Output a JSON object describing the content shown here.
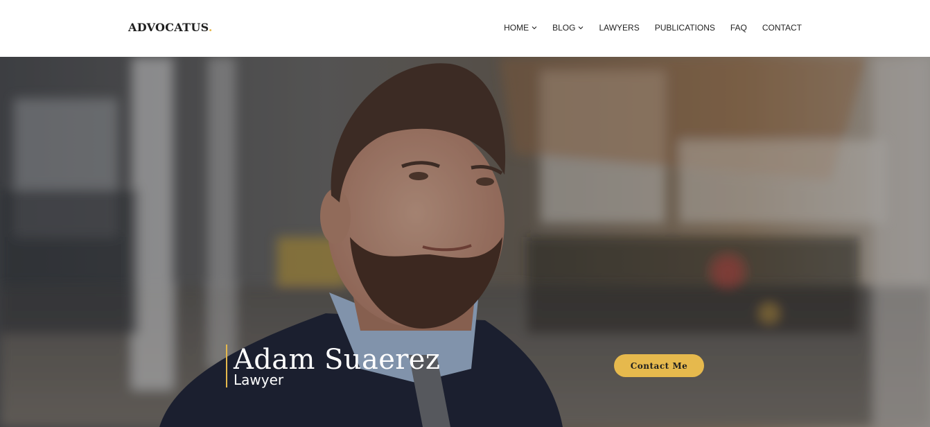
{
  "brand": {
    "name": "ADVOCATUS",
    "dot": ".",
    "accent": "#e6b94d"
  },
  "nav": {
    "items": [
      {
        "label": "HOME",
        "has_dropdown": true,
        "icon": "chevron-down-icon"
      },
      {
        "label": "BLOG",
        "has_dropdown": true,
        "icon": "chevron-down-icon"
      },
      {
        "label": "LAWYERS",
        "has_dropdown": false
      },
      {
        "label": "PUBLICATIONS",
        "has_dropdown": false
      },
      {
        "label": "FAQ",
        "has_dropdown": false
      },
      {
        "label": "CONTACT",
        "has_dropdown": false
      }
    ]
  },
  "hero": {
    "name": "Adam Suaerez",
    "role": "Lawyer",
    "cta_label": "Contact Me",
    "image": "portrait-photo"
  },
  "colors": {
    "accent": "#e6b94d",
    "nav_text": "#1f1f1f",
    "hero_text": "#ffffff"
  }
}
